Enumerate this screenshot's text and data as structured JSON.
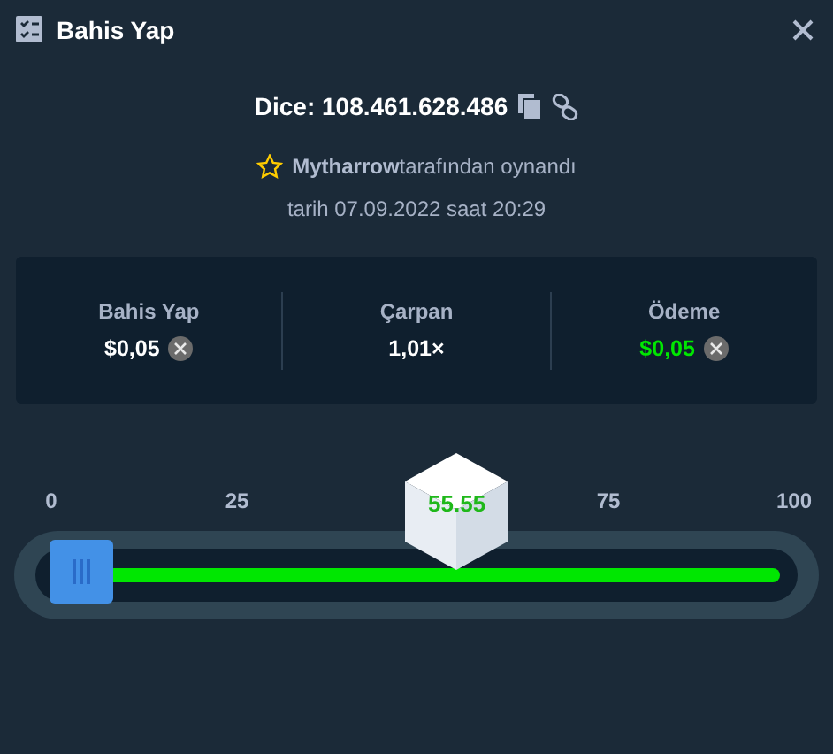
{
  "window": {
    "title": "Bahis Yap"
  },
  "bet": {
    "game": "Dice: 108.461.628.486",
    "player": "Mytharrow",
    "played_by": "tarafından oynandı",
    "date": "tarih 07.09.2022 saat 20:29"
  },
  "stats": [
    {
      "label": "Bahis Yap",
      "value": "$0,05",
      "coin": true,
      "win": false
    },
    {
      "label": "Çarpan",
      "value": "1,01×",
      "coin": false,
      "win": false
    },
    {
      "label": "Ödeme",
      "value": "$0,05",
      "coin": true,
      "win": true
    }
  ],
  "slider": {
    "ticks": [
      "0",
      "25",
      "75",
      "100"
    ],
    "result": {
      "value": "55.55",
      "win": true
    }
  }
}
